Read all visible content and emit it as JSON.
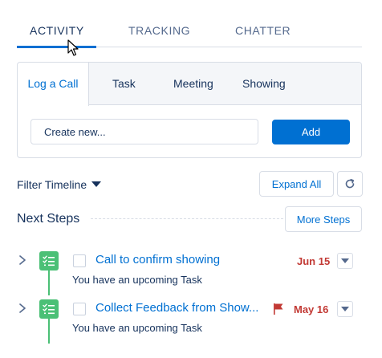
{
  "tabs": [
    {
      "label": "ACTIVITY",
      "active": true
    },
    {
      "label": "TRACKING",
      "active": false
    },
    {
      "label": "CHATTER",
      "active": false
    }
  ],
  "composer": {
    "tabs": [
      {
        "label": "Log a Call",
        "active": true
      },
      {
        "label": "Task",
        "active": false
      },
      {
        "label": "Meeting",
        "active": false
      },
      {
        "label": "Showing",
        "active": false
      }
    ],
    "input_placeholder": "Create new...",
    "add_label": "Add"
  },
  "timeline": {
    "filter_label": "Filter Timeline",
    "expand_all_label": "Expand All",
    "next_steps_title": "Next Steps",
    "more_steps_label": "More Steps",
    "items": [
      {
        "title": "Call to confirm showing",
        "subtitle": "You have an upcoming Task",
        "due": "Jun 15",
        "flagged": false
      },
      {
        "title": "Collect Feedback from Show...",
        "subtitle": "You have an upcoming Task",
        "due": "May 16",
        "flagged": true
      }
    ]
  },
  "colors": {
    "brand": "#0070d2",
    "task_green": "#4bc076",
    "overdue_red": "#c23934",
    "text": "#16325c",
    "border": "#d8dde6"
  },
  "icons": [
    "cursor-icon",
    "caret-down-icon",
    "refresh-icon",
    "chevron-right-icon",
    "task-icon",
    "flag-icon",
    "dropdown-icon"
  ]
}
